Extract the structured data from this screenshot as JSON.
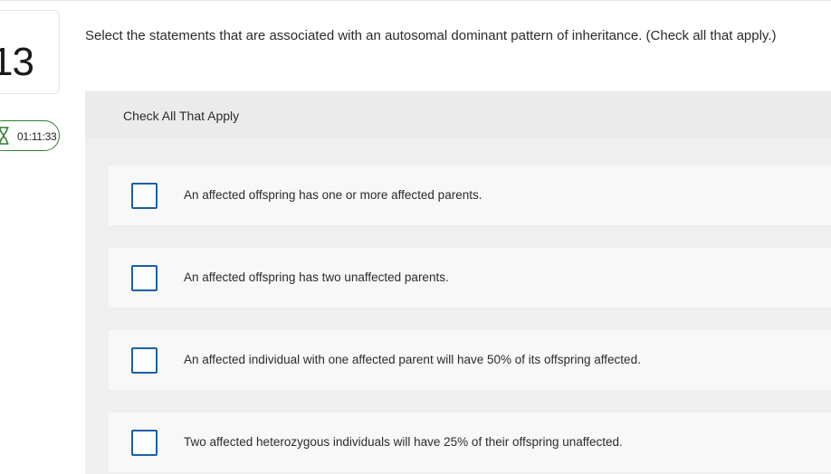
{
  "question": {
    "number": "13",
    "prompt": "Select the statements that are associated with an autosomal dominant pattern of inheritance. (Check all that apply.)"
  },
  "timer": {
    "icon": "hourglass-icon",
    "value": "01:11:33",
    "accent_color": "#2f7d32"
  },
  "panel": {
    "header": "Check All That Apply"
  },
  "options": [
    {
      "label": "An affected offspring has one or more affected parents.",
      "checked": false
    },
    {
      "label": "An affected offspring has two unaffected parents.",
      "checked": false
    },
    {
      "label": "An affected individual with one affected parent will have 50% of its offspring affected.",
      "checked": false
    },
    {
      "label": "Two affected heterozygous individuals will have 25% of their offspring unaffected.",
      "checked": false
    }
  ],
  "colors": {
    "checkbox_border": "#1a5fa8",
    "panel_bg": "#efefef",
    "option_bg": "#f8f8f8"
  }
}
